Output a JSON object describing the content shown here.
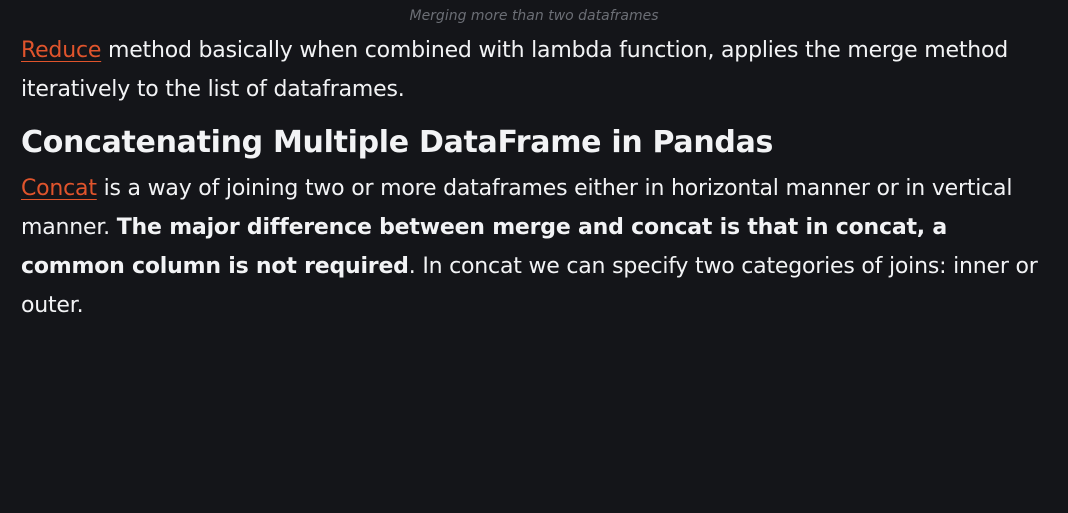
{
  "caption": "Merging more than two dataframes",
  "para1": {
    "link": "Reduce",
    "text": " method basically when combined with lambda function, applies the merge method iteratively to the list of dataframes."
  },
  "heading": "Concatenating Multiple DataFrame in Pandas",
  "para2": {
    "link": "Concat",
    "text_before_bold": " is a way of joining two or more dataframes either in horizontal manner or in vertical manner. ",
    "bold": "The major difference between merge and concat is that in concat, a common column is not required",
    "text_after_bold": ". In concat we can specify two categories of joins: inner or outer."
  },
  "colors": {
    "background": "#141519",
    "text": "#f2f3f5",
    "link": "#e0542c",
    "caption": "#6b6e75"
  }
}
